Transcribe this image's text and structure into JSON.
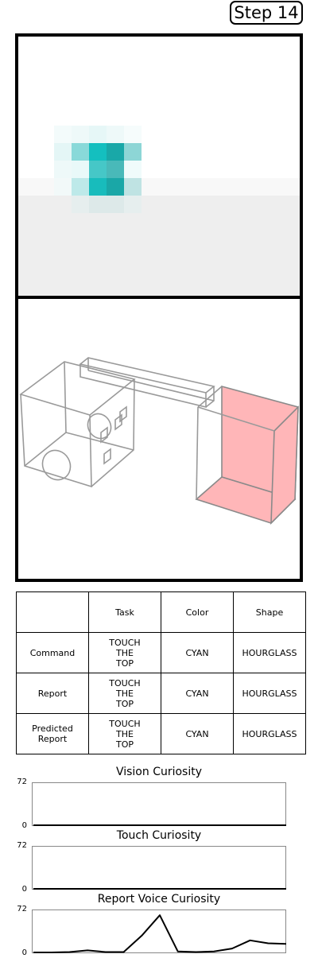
{
  "step_label": "Step 14",
  "table": {
    "headers": [
      "",
      "Task",
      "Color",
      "Shape"
    ],
    "rows": [
      {
        "label": "Command",
        "task": "TOUCH\nTHE\nTOP",
        "color": "CYAN",
        "shape": "HOURGLASS"
      },
      {
        "label": "Report",
        "task": "TOUCH\nTHE\nTOP",
        "color": "CYAN",
        "shape": "HOURGLASS"
      },
      {
        "label": "Predicted\nReport",
        "task": "TOUCH\nTHE\nTOP",
        "color": "CYAN",
        "shape": "HOURGLASS"
      }
    ]
  },
  "chart_data": [
    {
      "type": "line",
      "title": "Vision Curiosity",
      "ylim": [
        0,
        72
      ],
      "yticks": [
        "72",
        "0"
      ],
      "values": [
        0,
        0,
        0,
        0,
        0,
        0,
        0,
        0,
        0,
        0,
        0,
        0,
        0,
        0,
        0
      ]
    },
    {
      "type": "line",
      "title": "Touch Curiosity",
      "ylim": [
        0,
        72
      ],
      "yticks": [
        "72",
        "0"
      ],
      "values": [
        0,
        0,
        0,
        0,
        0,
        0,
        0,
        0,
        0,
        0,
        0,
        0,
        0,
        0,
        0
      ]
    },
    {
      "type": "line",
      "title": "Report Voice Curiosity",
      "ylim": [
        0,
        72
      ],
      "yticks": [
        "72",
        "0"
      ],
      "values": [
        0,
        1,
        2,
        5,
        2,
        2,
        30,
        65,
        3,
        2,
        3,
        8,
        22,
        17,
        16
      ]
    }
  ],
  "colors": {
    "cyan": "#14bfbf",
    "touch_pink": "#ffb6b8"
  }
}
